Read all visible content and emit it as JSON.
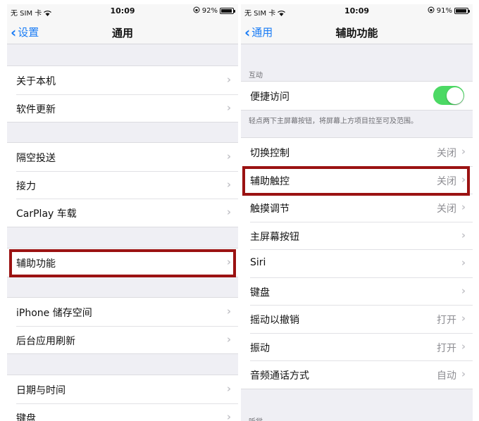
{
  "left": {
    "status": {
      "carrier": "无 SIM 卡",
      "time": "10:09",
      "battery": "92%",
      "battery_level": 0.92
    },
    "nav": {
      "back_label": "设置",
      "title": "通用"
    },
    "sections": [
      {
        "items": [
          {
            "label": "关于本机"
          },
          {
            "label": "软件更新"
          }
        ]
      },
      {
        "items": [
          {
            "label": "隔空投送"
          },
          {
            "label": "接力"
          },
          {
            "label": "CarPlay 车载"
          }
        ]
      },
      {
        "items": [
          {
            "label": "辅助功能"
          }
        ]
      },
      {
        "items": [
          {
            "label": "iPhone 储存空间"
          },
          {
            "label": "后台应用刷新"
          }
        ]
      },
      {
        "items": [
          {
            "label": "日期与时间"
          },
          {
            "label": "键盘"
          }
        ]
      }
    ]
  },
  "right": {
    "status": {
      "carrier": "无 SIM 卡",
      "time": "10:09",
      "battery": "91%",
      "battery_level": 0.91
    },
    "nav": {
      "back_label": "通用",
      "title": "辅助功能"
    },
    "group_header": "互动",
    "toggle_row": {
      "label": "便捷访问",
      "on": true
    },
    "footer_note": "轻点两下主屏幕按钮，将屏幕上方项目拉至可及范围。",
    "items": [
      {
        "label": "切换控制",
        "value": "关闭"
      },
      {
        "label": "辅助触控",
        "value": "关闭"
      },
      {
        "label": "触摸调节",
        "value": "关闭"
      },
      {
        "label": "主屏幕按钮",
        "value": ""
      },
      {
        "label": "Siri",
        "value": ""
      },
      {
        "label": "键盘",
        "value": ""
      },
      {
        "label": "摇动以撤销",
        "value": "打开"
      },
      {
        "label": "振动",
        "value": "打开"
      },
      {
        "label": "音频通话方式",
        "value": "自动"
      }
    ],
    "cut_header": "听觉"
  },
  "colors": {
    "accent": "#1a7cf5",
    "toggle_on": "#4cd964",
    "highlight": "#9b1212",
    "background": "#efeff4"
  }
}
